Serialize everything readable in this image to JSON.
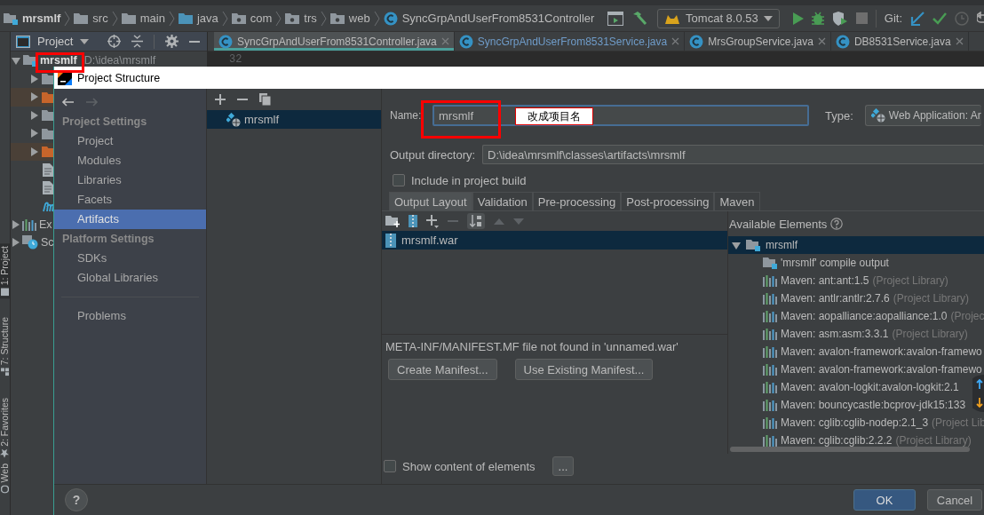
{
  "top_bar": {
    "breadcrumbs": [
      {
        "kind": "module",
        "label": "mrsmlf"
      },
      {
        "kind": "folder",
        "label": "src"
      },
      {
        "kind": "folder",
        "label": "main"
      },
      {
        "kind": "source_folder",
        "label": "java"
      },
      {
        "kind": "package",
        "label": "com"
      },
      {
        "kind": "package",
        "label": "trs"
      },
      {
        "kind": "package",
        "label": "web"
      },
      {
        "kind": "class",
        "label": "SyncGrpAndUserFrom8531Controller"
      }
    ],
    "run_configuration": "Tomcat 8.0.53",
    "vcs_label": "Git:"
  },
  "tool_strip": [
    {
      "label": "1: Project",
      "selected": true
    },
    {
      "label": "7: Structure",
      "selected": false
    },
    {
      "label": "2: Favorites",
      "selected": false
    },
    {
      "label": "Web",
      "selected": false
    }
  ],
  "project_panel": {
    "title": "Project",
    "tree": [
      {
        "kind": "module",
        "label": "mrsmlf",
        "path": "D:\\idea\\mrsmlf",
        "expanded": true,
        "children": [
          {
            "kind": "folder",
            "expanded": false
          },
          {
            "kind": "excluded_folder",
            "expanded": false
          },
          {
            "kind": "folder",
            "expanded": false
          },
          {
            "kind": "folder",
            "expanded": false
          },
          {
            "kind": "excluded_folder",
            "expanded": false
          },
          {
            "kind": "file"
          },
          {
            "kind": "file"
          },
          {
            "kind": "maven_file"
          }
        ]
      },
      {
        "kind": "libraries",
        "label": "Ex",
        "expanded": false
      },
      {
        "kind": "scratches",
        "label": "Sc",
        "expanded": false
      }
    ]
  },
  "editor": {
    "tabs": [
      {
        "label": "SyncGrpAndUserFrom8531Controller.java",
        "selected": true,
        "modified": false
      },
      {
        "label": "SyncGrpAndUserFrom8531Service.java",
        "selected": false,
        "modified": true
      },
      {
        "label": "MrsGroupService.java",
        "selected": false,
        "modified": false
      },
      {
        "label": "DB8531Service.java",
        "selected": false,
        "modified": false
      }
    ],
    "line_number": "32"
  },
  "dialog": {
    "title": "Project Structure",
    "nav": {
      "sections": [
        {
          "heading": "Project Settings",
          "items": [
            {
              "label": "Project",
              "selected": false
            },
            {
              "label": "Modules",
              "selected": false
            },
            {
              "label": "Libraries",
              "selected": false
            },
            {
              "label": "Facets",
              "selected": false
            },
            {
              "label": "Artifacts",
              "selected": true
            }
          ]
        },
        {
          "heading": "Platform Settings",
          "items": [
            {
              "label": "SDKs",
              "selected": false
            },
            {
              "label": "Global Libraries",
              "selected": false
            }
          ]
        }
      ],
      "extra": [
        {
          "label": "Problems",
          "selected": false
        }
      ]
    },
    "artifacts": [
      {
        "label": "mrsmlf",
        "selected": true
      }
    ],
    "name": {
      "label": "Name:",
      "value": "mrsmlf"
    },
    "type": {
      "label": "Type:",
      "value": "Web Application: Ar"
    },
    "output_directory": {
      "label": "Output directory:",
      "value": "D:\\idea\\mrsmlf\\classes\\artifacts\\mrsmlf"
    },
    "include_in_build": {
      "label": "Include in project build",
      "checked": false
    },
    "tabs": [
      {
        "label": "Output Layout",
        "selected": true
      },
      {
        "label": "Validation",
        "selected": false
      },
      {
        "label": "Pre-processing",
        "selected": false
      },
      {
        "label": "Post-processing",
        "selected": false
      },
      {
        "label": "Maven",
        "selected": false
      }
    ],
    "output_tree": [
      {
        "label": "mrsmlf.war",
        "selected": true
      }
    ],
    "manifest_message": "META-INF/MANIFEST.MF file not found in 'unnamed.war'",
    "manifest_buttons": [
      "Create Manifest...",
      "Use Existing Manifest..."
    ],
    "available": {
      "title": "Available Elements",
      "tree": [
        {
          "label": "mrsmlf",
          "expanded": true,
          "selected": true,
          "children": [
            {
              "kind": "output",
              "label": "'mrsmlf' compile output"
            },
            {
              "kind": "library",
              "label": "Maven: ant:ant:1.5",
              "note": "(Project Library)"
            },
            {
              "kind": "library",
              "label": "Maven: antlr:antlr:2.7.6",
              "note": "(Project Library)"
            },
            {
              "kind": "library",
              "label": "Maven: aopalliance:aopalliance:1.0",
              "note": "(Projec"
            },
            {
              "kind": "library",
              "label": "Maven: asm:asm:3.3.1",
              "note": "(Project Library)"
            },
            {
              "kind": "library",
              "label": "Maven: avalon-framework:avalon-framewo"
            },
            {
              "kind": "library",
              "label": "Maven: avalon-framework:avalon-framewo"
            },
            {
              "kind": "library",
              "label": "Maven: avalon-logkit:avalon-logkit:2.1"
            },
            {
              "kind": "library",
              "label": "Maven: bouncycastle:bcprov-jdk15:133"
            },
            {
              "kind": "library",
              "label": "Maven: cglib:cglib-nodep:2.1_3",
              "note": "(Project Lib"
            },
            {
              "kind": "library",
              "label": "Maven: cglib:cglib:2.2.2",
              "note": "(Project Library)"
            }
          ]
        }
      ]
    },
    "show_content": {
      "label": "Show content of elements",
      "checked": false
    },
    "more_button": "...",
    "footer": {
      "help": "?",
      "ok": "OK",
      "cancel": "Cancel"
    }
  },
  "annotation": {
    "callout": "改成项目名"
  }
}
